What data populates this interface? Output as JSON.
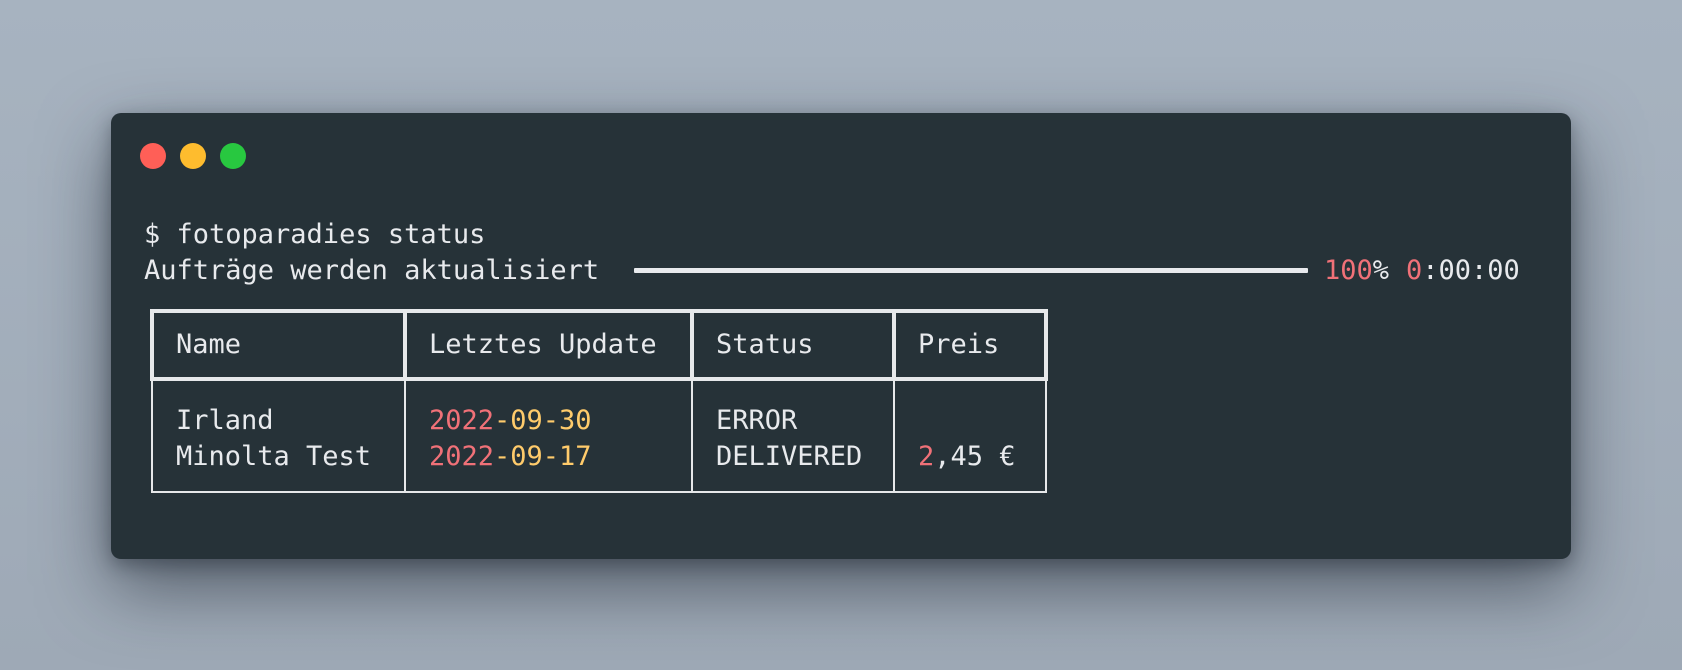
{
  "window": {
    "colors": {
      "background": "#263238",
      "close": "#ff5f57",
      "minimize": "#febc2e",
      "zoom": "#28c840"
    }
  },
  "terminal": {
    "prompt": "$ fotoparadies status",
    "progress": {
      "label": "Aufträge werden aktualisiert",
      "percent_number": "100",
      "percent_sign": "%",
      "time_prefix": "0",
      "time_rest": ":00:00",
      "fill": 1.0
    }
  },
  "table": {
    "headers": {
      "name": "Name",
      "updated": "Letztes Update",
      "status": "Status",
      "price": "Preis"
    },
    "rows": [
      {
        "name": "Irland",
        "date_year": "2022",
        "date_rest": "-09-30",
        "status": "ERROR",
        "price_int": "",
        "price_rest": ""
      },
      {
        "name": "Minolta Test",
        "date_year": "2022",
        "date_rest": "-09-17",
        "status": "DELIVERED",
        "price_int": "2",
        "price_rest": ",45 €"
      }
    ]
  }
}
